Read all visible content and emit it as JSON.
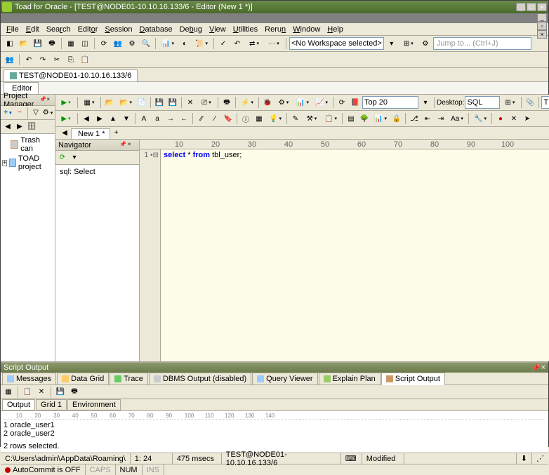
{
  "window": {
    "title": "Toad for Oracle - [TEST@NODE01-10.10.16.133/6 - Editor (New 1 *)]"
  },
  "menu": {
    "file": "File",
    "edit": "Edit",
    "search": "Search",
    "editor": "Editor",
    "session": "Session",
    "database": "Database",
    "debug": "Debug",
    "view": "View",
    "utilities": "Utilities",
    "rerun": "Rerun",
    "window": "Window",
    "help": "Help"
  },
  "toolbar1": {
    "workspace": "<No Workspace selected>",
    "jumpto": "Jump to... (Ctrl+J)"
  },
  "conntab": {
    "label": "TEST@NODE01-10.10.16.133/6"
  },
  "editortab": {
    "label": "Editor"
  },
  "rtoolbar": {
    "top_label": "Top 20",
    "desktop_label": "Desktop:",
    "desktop_value": "SQL",
    "conn": "TEST"
  },
  "project": {
    "title": "Project Manager",
    "trash": "Trash can",
    "toad": "TOAD project"
  },
  "newtab": {
    "label": "New 1 *"
  },
  "navigator": {
    "title": "Navigator",
    "item": "sql: Select"
  },
  "ruler": {
    "marks": [
      "10",
      "20",
      "30",
      "40",
      "50",
      "60",
      "70",
      "80",
      "90",
      "100"
    ]
  },
  "code": {
    "line_no": "1",
    "kw1": "select",
    "star": "*",
    "kw2": "from",
    "tbl": "tbl_user",
    "semi": ";"
  },
  "output": {
    "title": "Script Output",
    "tabs": {
      "messages": "Messages",
      "datagrid": "Data Grid",
      "trace": "Trace",
      "dbms": "DBMS Output (disabled)",
      "query": "Query Viewer",
      "explain": "Explain Plan",
      "script": "Script Output"
    },
    "subtabs": {
      "output": "Output",
      "grid1": "Grid 1",
      "env": "Environment"
    },
    "ruler": "        10        20        30        40        50        60        70        80        90        100       110       120       130       140",
    "row1_n": "1",
    "row1_v": "oracle_user1",
    "row2_n": "2",
    "row2_v": "oracle_user2",
    "summary": "2 rows selected."
  },
  "status": {
    "path": "C:\\Users\\admin\\AppData\\Roaming\\",
    "pos": "1: 24",
    "time": "475 msecs",
    "conn": "TEST@NODE01-10.10.16.133/6",
    "mod": "Modified"
  },
  "status2": {
    "autocommit": "AutoCommit is OFF",
    "caps": "CAPS",
    "num": "NUM",
    "ins": "INS"
  }
}
